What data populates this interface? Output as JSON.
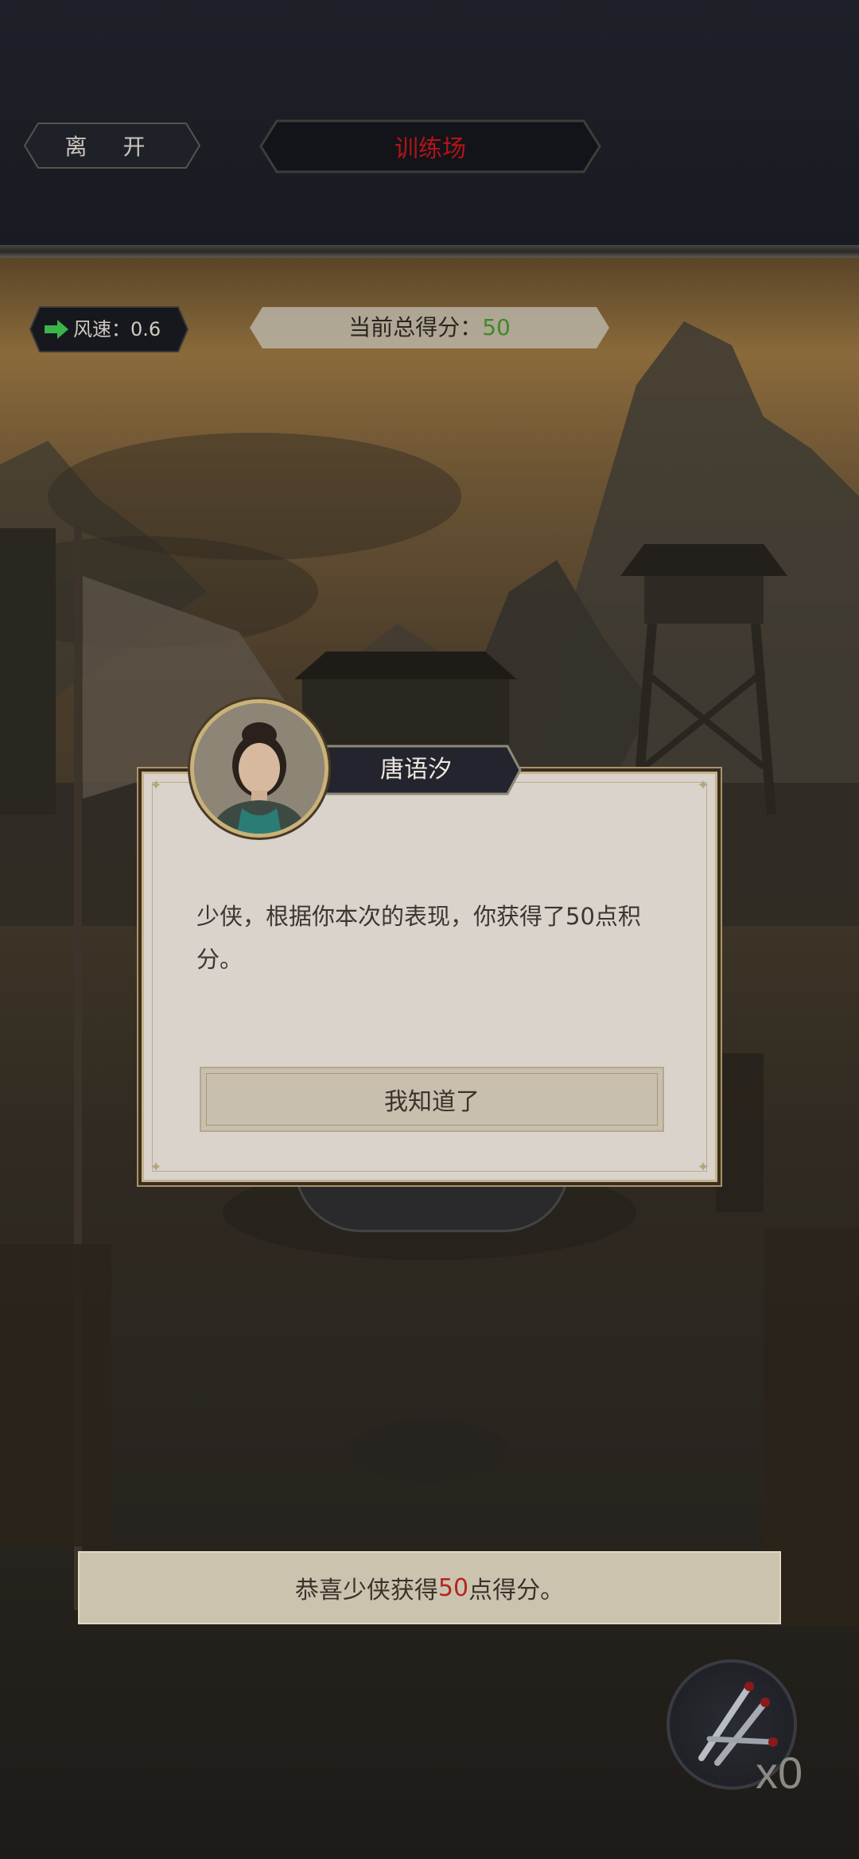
{
  "header": {
    "leave_label": "离 开",
    "title": "训练场"
  },
  "hud": {
    "wind_label": "风速：0.6",
    "score_label": "当前总得分：",
    "score_value": "50"
  },
  "dialog": {
    "speaker_name": "唐语汐",
    "message": "少侠，根据你本次的表现，你获得了50点积分。",
    "confirm_label": "我知道了"
  },
  "toast": {
    "prefix": "恭喜少侠获得",
    "value": "50",
    "suffix": "点得分。"
  },
  "darts": {
    "count": "x0"
  },
  "colors": {
    "title_red": "#b0141a",
    "score_green": "#3e8a2a",
    "highlight_red": "#b3261e"
  }
}
